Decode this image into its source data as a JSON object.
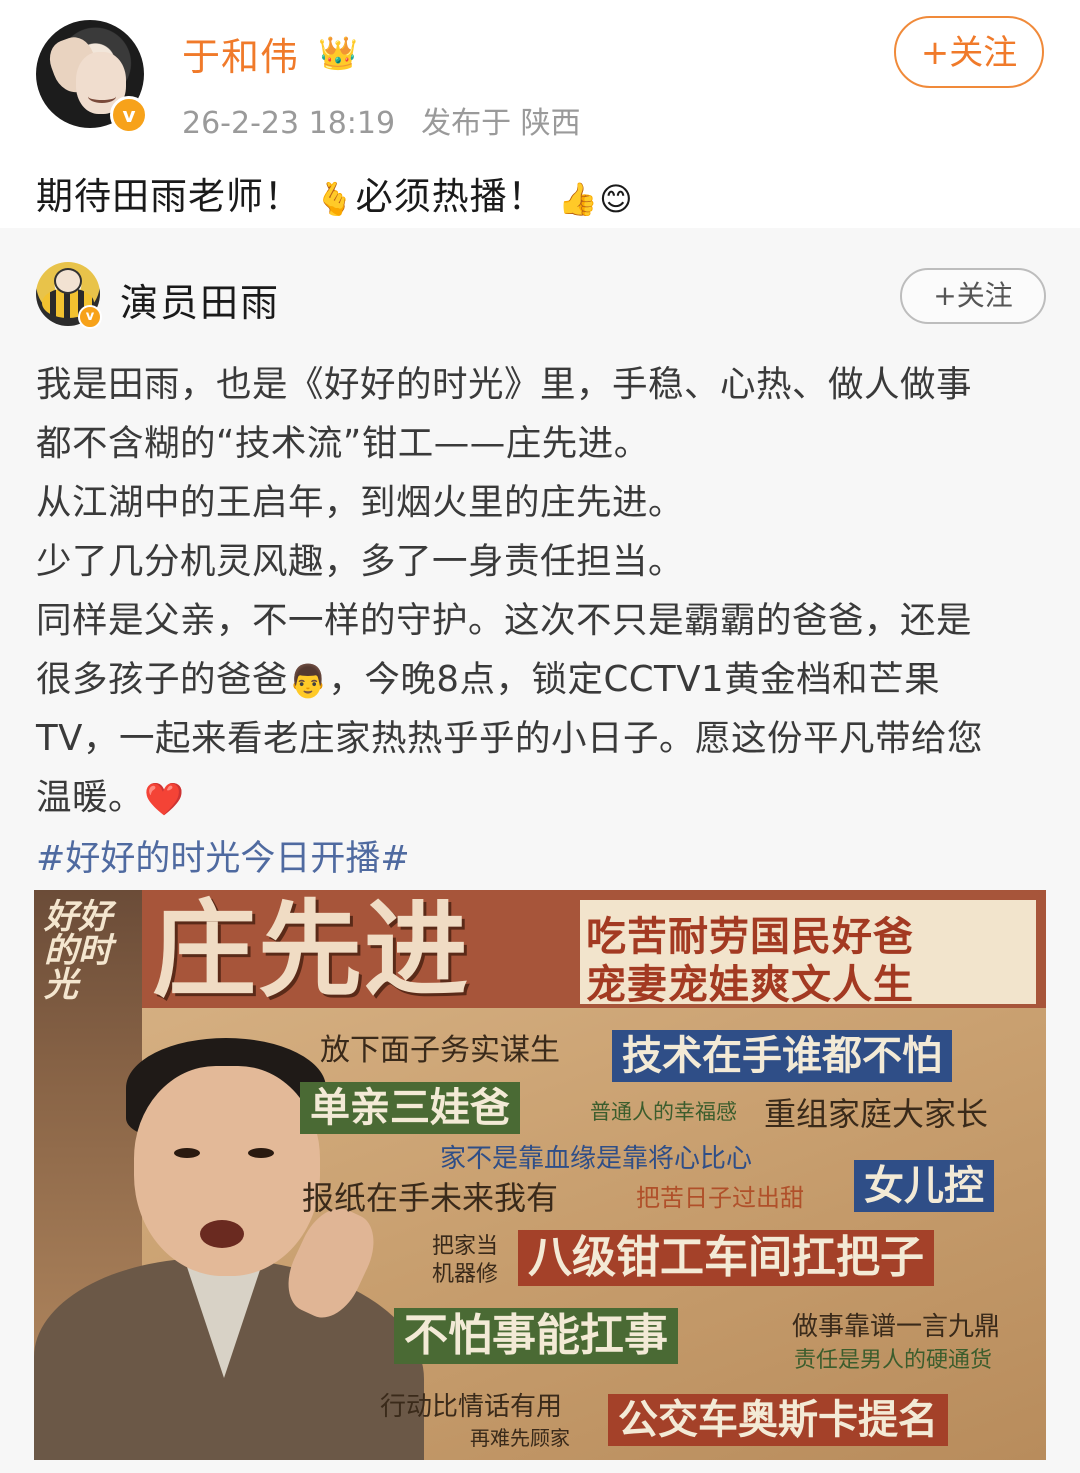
{
  "post": {
    "username": "于和伟",
    "crown_icon": "crown-icon",
    "verified_icon": "verified-badge-icon",
    "timestamp": "26-2-23 18:19",
    "location": "发布于 陕西",
    "follow_label": "+关注",
    "text_part1": "期待田雨老师！",
    "emoji1": "🫰",
    "text_part2": "必须热播！",
    "emoji2": "👍",
    "emoji3": "😊"
  },
  "repost": {
    "username": "演员田雨",
    "follow_label": "+关注",
    "lines": [
      "我是田雨，也是《好好的时光》里，手稳、心热、做人做事",
      "都不含糊的“技术流”钳工——庄先进。",
      "从江湖中的王启年，到烟火里的庄先进。",
      "少了几分机灵风趣，多了一身责任担当。",
      "同样是父亲，不一样的守护。这次不只是霸霸的爸爸，还是",
      "很多孩子的爸爸",
      "，今晚8点，锁定CCTV1黄金档和芒果",
      "TV，一起来看老庄家热热乎乎的小日子。愿这份平凡带给您",
      "温暖。"
    ],
    "emoji_man": "👨",
    "emoji_heart": "❤️",
    "hashtag": "#好好的时光今日开播#"
  },
  "poster": {
    "logo": "好好的时光",
    "name": "庄先进",
    "slogan1": "吃苦耐劳国民好爸",
    "slogan2": "宠妻宠娃爽文人生",
    "tags": {
      "t1": "放下面子务实谋生",
      "t2": "技术在手谁都不怕",
      "t3": "单亲三娃爸",
      "t4": "普通人的幸福感",
      "t5": "重组家庭大家长",
      "t6": "家不是靠血缘是靠将心比心",
      "t7": "报纸在手未来我有",
      "t8": "把苦日子过出甜",
      "t9": "女儿控",
      "t10a": "把家当",
      "t10b": "机器修",
      "t11": "八级钳工车间扛把子",
      "t12": "不怕事能扛事",
      "t13": "做事靠谱一言九鼎",
      "t14": "责任是男人的硬通货",
      "t15": "行动比情话有用",
      "t16": "再难先顾家",
      "t17": "公交车奥斯卡提名"
    }
  },
  "colors": {
    "username_orange": "#f07a2a",
    "hashtag_blue": "#4f6aa0",
    "card_bg": "#f7f7f7"
  }
}
